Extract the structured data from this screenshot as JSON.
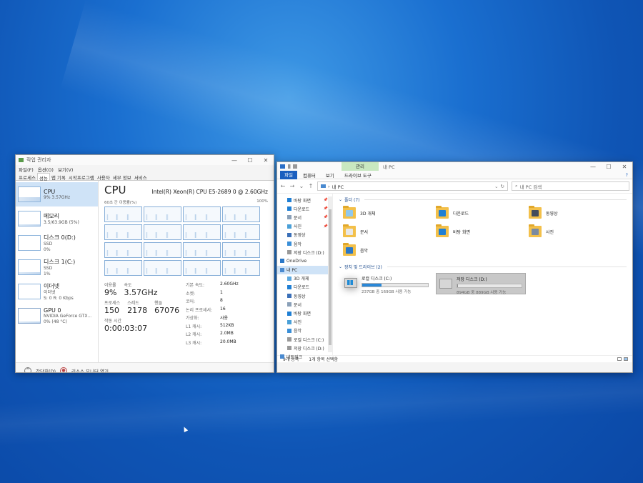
{
  "task_manager": {
    "title": "작업 관리자",
    "menu": [
      "파일(F)",
      "옵션(O)",
      "보기(V)"
    ],
    "tabs": [
      "프로세스",
      "성능",
      "앱 기록",
      "시작프로그램",
      "사용자",
      "세부 정보",
      "서비스"
    ],
    "active_tab": "성능",
    "sidebar": [
      {
        "title": "CPU",
        "sub": "9% 3.57GHz",
        "sub2": ""
      },
      {
        "title": "메모리",
        "sub": "3.5/63.9GB (5%)",
        "sub2": ""
      },
      {
        "title": "디스크 0(D:)",
        "sub": "SSD",
        "sub2": "0%"
      },
      {
        "title": "디스크 1(C:)",
        "sub": "SSD",
        "sub2": "1%"
      },
      {
        "title": "이더넷",
        "sub": "이더넷",
        "sub2": "S: 0 R: 0 Kbps"
      },
      {
        "title": "GPU 0",
        "sub": "NVIDIA GeForce GTX...",
        "sub2": "0% (48 °C)"
      }
    ],
    "cpu": {
      "heading": "CPU",
      "model": "Intel(R) Xeon(R) CPU E5-2689 0 @ 2.60GHz",
      "graph_left": "60초 간 이용률(%)",
      "graph_right": "100%",
      "util_label": "이용률",
      "util_value": "9%",
      "speed_label": "속도",
      "speed_value": "3.57GHz",
      "proc_label": "프로세스",
      "proc_value": "150",
      "thread_label": "스레드",
      "thread_value": "2178",
      "handle_label": "핸들",
      "handle_value": "67076",
      "uptime_label": "작동 시간",
      "uptime_value": "0:00:03:07",
      "specs": [
        {
          "k": "기본 속도:",
          "v": "2.60GHz"
        },
        {
          "k": "소켓:",
          "v": "1"
        },
        {
          "k": "코어:",
          "v": "8"
        },
        {
          "k": "논리 프로세서:",
          "v": "16"
        },
        {
          "k": "가상화:",
          "v": "사용"
        },
        {
          "k": "L1 캐시:",
          "v": "512KB"
        },
        {
          "k": "L2 캐시:",
          "v": "2.0MB"
        },
        {
          "k": "L3 캐시:",
          "v": "20.0MB"
        }
      ]
    },
    "footer_brief": "간단히(D)",
    "footer_monitor": "리소스 모니터 열기"
  },
  "explorer": {
    "title": "내 PC",
    "context_tab": "관리",
    "ribbon_tabs": [
      "파일",
      "컴퓨터",
      "보기",
      "드라이브 도구"
    ],
    "address": "내 PC",
    "search_placeholder": "내 PC 검색",
    "nav": [
      {
        "label": "바탕 화면",
        "pin": true,
        "color": "#1f7fd4",
        "top": false
      },
      {
        "label": "다운로드",
        "pin": true,
        "color": "#1f7fd4",
        "top": false
      },
      {
        "label": "문서",
        "pin": true,
        "color": "#8aa0b8",
        "top": false
      },
      {
        "label": "사진",
        "pin": true,
        "color": "#4aa0d8",
        "top": false
      },
      {
        "label": "동영상",
        "pin": false,
        "color": "#3a6fb8",
        "top": false
      },
      {
        "label": "음악",
        "pin": false,
        "color": "#3a8fd8",
        "top": false
      },
      {
        "label": "저장 디스크 (D:)",
        "pin": false,
        "color": "#999999",
        "top": false
      },
      {
        "label": "OneDrive",
        "pin": false,
        "color": "#2a78c8",
        "top": true
      },
      {
        "label": "내 PC",
        "pin": false,
        "color": "#4a8ad0",
        "top": true
      },
      {
        "label": "3D 개체",
        "pin": false,
        "color": "#5aa8e0",
        "top": false
      },
      {
        "label": "다운로드",
        "pin": false,
        "color": "#1f7fd4",
        "top": false
      },
      {
        "label": "동영상",
        "pin": false,
        "color": "#3a6fb8",
        "top": false
      },
      {
        "label": "문서",
        "pin": false,
        "color": "#8aa0b8",
        "top": false
      },
      {
        "label": "바탕 화면",
        "pin": false,
        "color": "#1f7fd4",
        "top": false
      },
      {
        "label": "사진",
        "pin": false,
        "color": "#4aa0d8",
        "top": false
      },
      {
        "label": "음악",
        "pin": false,
        "color": "#3a8fd8",
        "top": false
      },
      {
        "label": "로컬 디스크 (C:)",
        "pin": false,
        "color": "#999999",
        "top": false
      },
      {
        "label": "저장 디스크 (D:)",
        "pin": false,
        "color": "#999999",
        "top": false
      },
      {
        "label": "네트워크",
        "pin": false,
        "color": "#4a8ad0",
        "top": true
      }
    ],
    "nav_selected_index": 8,
    "folders_header": "폴더 (7)",
    "folders": [
      {
        "label": "3D 개체",
        "glyph": "#8fc8ee"
      },
      {
        "label": "다운로드",
        "glyph": "#1f7fd4"
      },
      {
        "label": "동영상",
        "glyph": "#444c5c"
      },
      {
        "label": "문서",
        "glyph": "#e8e8e8"
      },
      {
        "label": "바탕 화면",
        "glyph": "#1f7fd4"
      },
      {
        "label": "사진",
        "glyph": "#7a8aa0"
      },
      {
        "label": "음악",
        "glyph": "#2a78c8"
      }
    ],
    "drives_header": "장치 및 드라이브 (2)",
    "drives": [
      {
        "name": "로컬 디스크 (C:)",
        "sub": "237GB 중 169GB 사용 가능",
        "used_fraction": 0.29,
        "selected": false
      },
      {
        "name": "저장 디스크 (D:)",
        "sub": "894GB 중 889GB 사용 가능",
        "used_fraction": 0.01,
        "selected": true
      }
    ],
    "status_count": "9개 항목",
    "status_selected": "1개 항목 선택함"
  }
}
